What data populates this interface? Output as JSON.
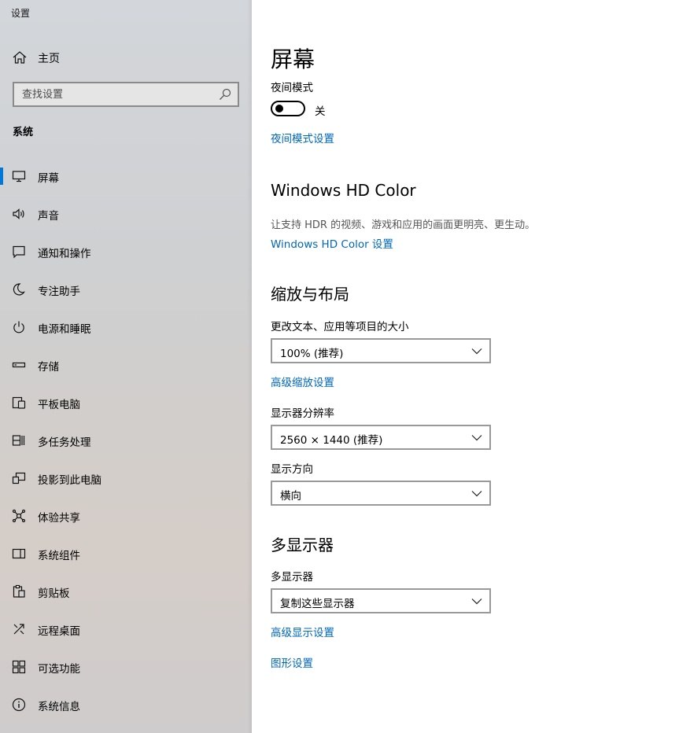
{
  "window": {
    "title": "设置"
  },
  "sidebar": {
    "home_label": "主页",
    "search_placeholder": "查找设置",
    "section": "系统",
    "items": [
      {
        "label": "屏幕",
        "icon": "monitor-icon",
        "selected": true
      },
      {
        "label": "声音",
        "icon": "speaker-icon"
      },
      {
        "label": "通知和操作",
        "icon": "notification-icon"
      },
      {
        "label": "专注助手",
        "icon": "moon-icon"
      },
      {
        "label": "电源和睡眠",
        "icon": "power-icon"
      },
      {
        "label": "存储",
        "icon": "storage-icon"
      },
      {
        "label": "平板电脑",
        "icon": "tablet-icon"
      },
      {
        "label": "多任务处理",
        "icon": "multitasking-icon"
      },
      {
        "label": "投影到此电脑",
        "icon": "projecting-icon"
      },
      {
        "label": "体验共享",
        "icon": "shared-experiences-icon"
      },
      {
        "label": "系统组件",
        "icon": "system-components-icon"
      },
      {
        "label": "剪贴板",
        "icon": "clipboard-icon"
      },
      {
        "label": "远程桌面",
        "icon": "remote-desktop-icon"
      },
      {
        "label": "可选功能",
        "icon": "optional-features-icon"
      },
      {
        "label": "系统信息",
        "icon": "info-icon"
      }
    ]
  },
  "main": {
    "title": "屏幕",
    "night_light": {
      "label": "夜间模式",
      "state_label": "关",
      "on": false,
      "settings_link": "夜间模式设置"
    },
    "hdr": {
      "heading": "Windows HD Color",
      "description": "让支持 HDR 的视频、游戏和应用的画面更明亮、更生动。",
      "link": "Windows HD Color 设置"
    },
    "scale_layout": {
      "heading": "缩放与布局",
      "scale_label": "更改文本、应用等项目的大小",
      "scale_value": "100% (推荐)",
      "advanced_scaling_link": "高级缩放设置",
      "resolution_label": "显示器分辨率",
      "resolution_value": "2560 × 1440 (推荐)",
      "orientation_label": "显示方向",
      "orientation_value": "横向"
    },
    "multi_display": {
      "heading": "多显示器",
      "label": "多显示器",
      "value": "复制这些显示器",
      "advanced_link": "高级显示设置",
      "graphics_link": "图形设置"
    }
  },
  "colors": {
    "accent": "#0078d7",
    "link": "#0067b8"
  }
}
